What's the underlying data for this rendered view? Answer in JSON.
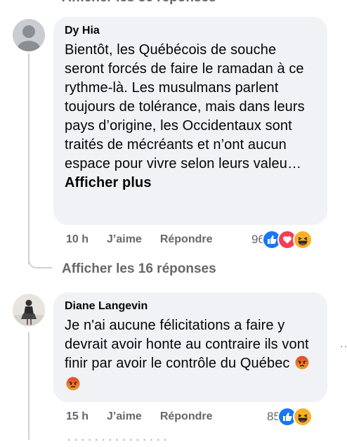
{
  "top_cut_text": "Afficher les 36 réponses",
  "comments": [
    {
      "author": "Dy Hia",
      "text": "Bientôt, les Québécois de souche seront forcés de faire le ramadan à ce rythme-là. Les musulmans parlent toujours de tolérance, mais dans leurs pays d’origine, les Occidentaux sont traités de mécréants et n’ont aucun espace pour vivre selon leurs valeu…",
      "more_label": "Afficher plus",
      "time": "10 h",
      "like_label": "J’aime",
      "reply_label": "Répondre",
      "reaction_count": "96",
      "reactions": [
        "like-icon",
        "love-icon",
        "haha-icon"
      ]
    },
    {
      "author": "Diane Langevin",
      "text": "Je n'ai aucune félicitations a faire y devrait avoir honte au contraire ils vont finir par avoir le contrôle du Québec",
      "emojis": [
        "angry-face-icon",
        "angry-face-icon"
      ],
      "time": "15 h",
      "like_label": "J’aime",
      "reply_label": "Répondre",
      "reaction_count": "85",
      "reactions": [
        "like-icon",
        "haha-icon"
      ]
    }
  ],
  "replies_link": "Afficher les 16 réponses",
  "colors": {
    "like": "#1877f2",
    "love": "#f33e58",
    "haha": "#f7b125",
    "bubble": "#f0f2f5",
    "muted": "#65676b"
  }
}
